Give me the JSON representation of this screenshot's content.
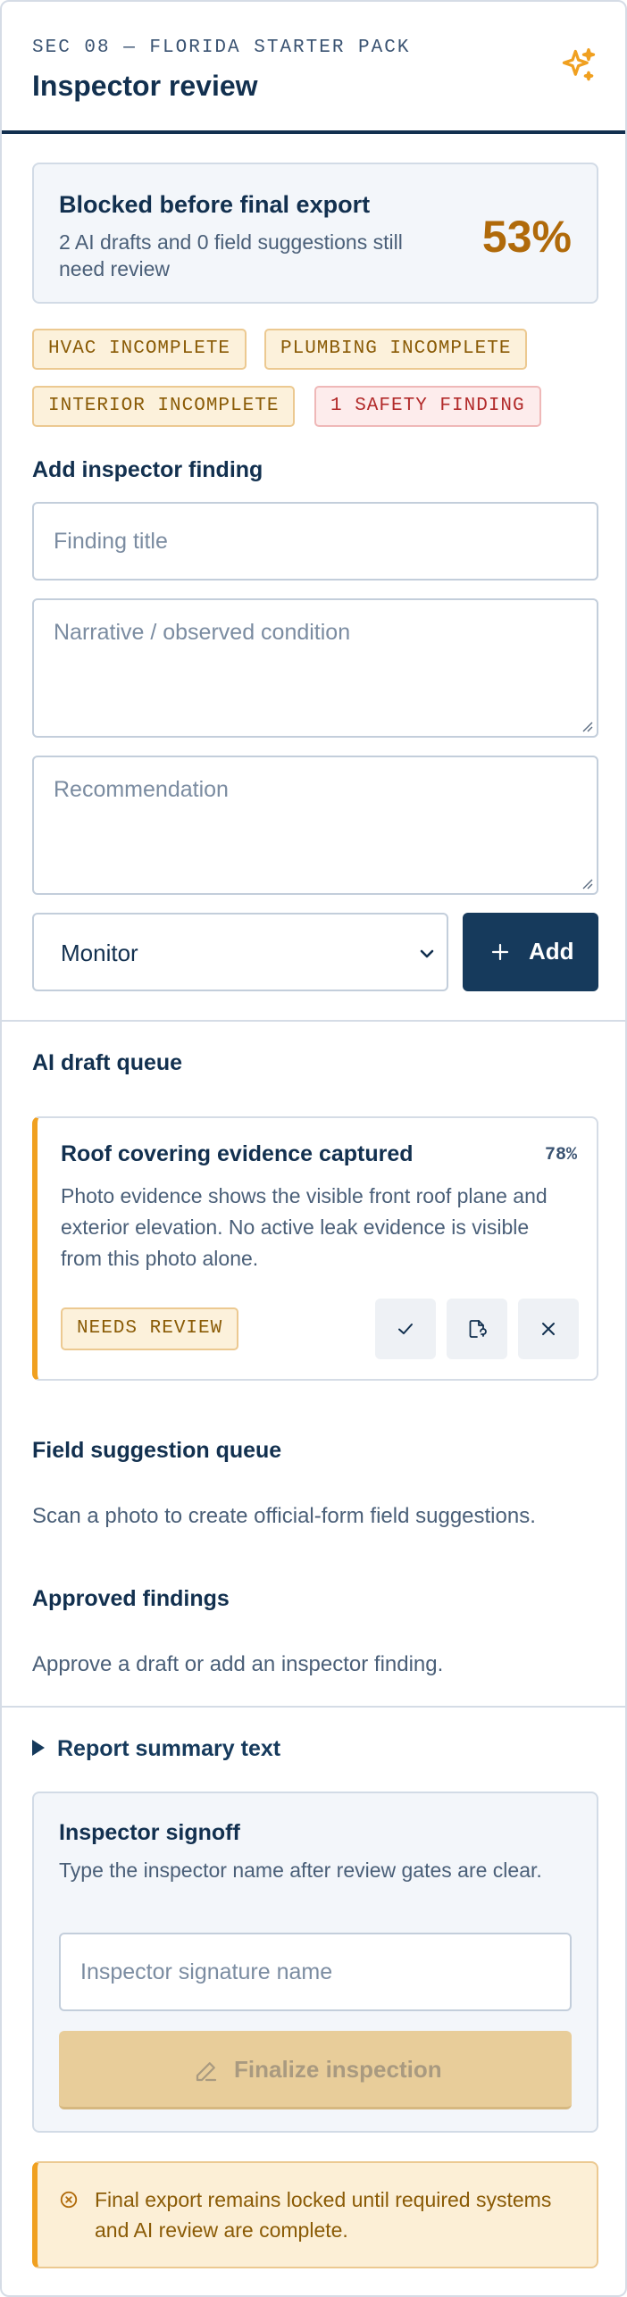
{
  "header": {
    "eyebrow": "SEC 08 — FLORIDA STARTER PACK",
    "title": "Inspector review",
    "icon": "sparkle-icon"
  },
  "status": {
    "title": "Blocked before final export",
    "subtitle": "2 AI drafts and 0 field suggestions still need review",
    "percent": "53%"
  },
  "chips": [
    {
      "label": "HVAC INCOMPLETE",
      "kind": "warn"
    },
    {
      "label": "PLUMBING INCOMPLETE",
      "kind": "warn"
    },
    {
      "label": "INTERIOR INCOMPLETE",
      "kind": "warn"
    },
    {
      "label": "1 SAFETY FINDING",
      "kind": "danger"
    }
  ],
  "add_finding": {
    "heading": "Add inspector finding",
    "title_placeholder": "Finding title",
    "narrative_placeholder": "Narrative / observed condition",
    "recommendation_placeholder": "Recommendation",
    "severity_value": "Monitor",
    "add_label": "Add"
  },
  "ai_queue": {
    "heading": "AI draft queue",
    "draft": {
      "title": "Roof covering evidence captured",
      "confidence": "78%",
      "body": "Photo evidence shows the visible front roof plane and exterior elevation. No active leak evidence is visible from this photo alone.",
      "badge": "NEEDS REVIEW"
    }
  },
  "field_queue": {
    "heading": "Field suggestion queue",
    "empty": "Scan a photo to create official-form field suggestions."
  },
  "approved": {
    "heading": "Approved findings",
    "empty": "Approve a draft or add an inspector finding."
  },
  "summary": {
    "label": "Report summary text"
  },
  "signoff": {
    "title": "Inspector signoff",
    "subtitle": "Type the inspector name after review gates are clear.",
    "placeholder": "Inspector signature name",
    "finalize_label": "Finalize inspection"
  },
  "alert": {
    "message": "Final export remains locked until required systems and AI review are complete."
  },
  "colors": {
    "navy": "#163a5c",
    "amber": "#f0a020",
    "danger": "#b22a2a"
  }
}
